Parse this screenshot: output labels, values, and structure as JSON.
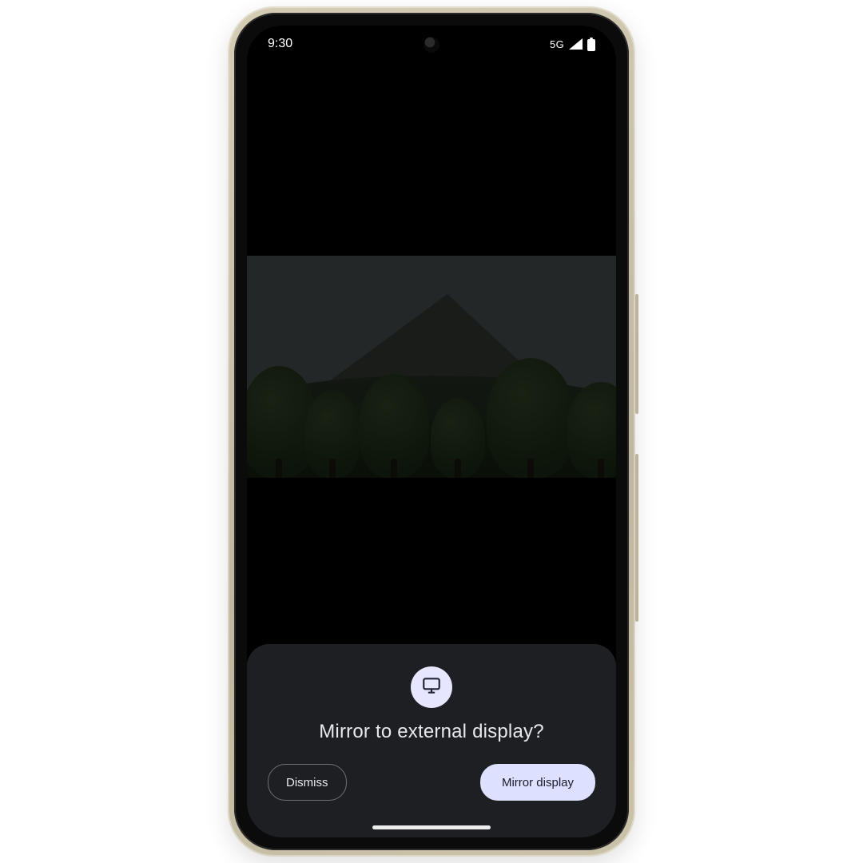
{
  "status": {
    "time": "9:30",
    "network_label": "5G"
  },
  "sheet": {
    "title": "Mirror to external display?",
    "dismiss_label": "Dismiss",
    "confirm_label": "Mirror display"
  },
  "colors": {
    "accent_badge": "#e6e7ff",
    "accent_pill": "#dde0ff",
    "panel_bg": "#1d1f22"
  }
}
